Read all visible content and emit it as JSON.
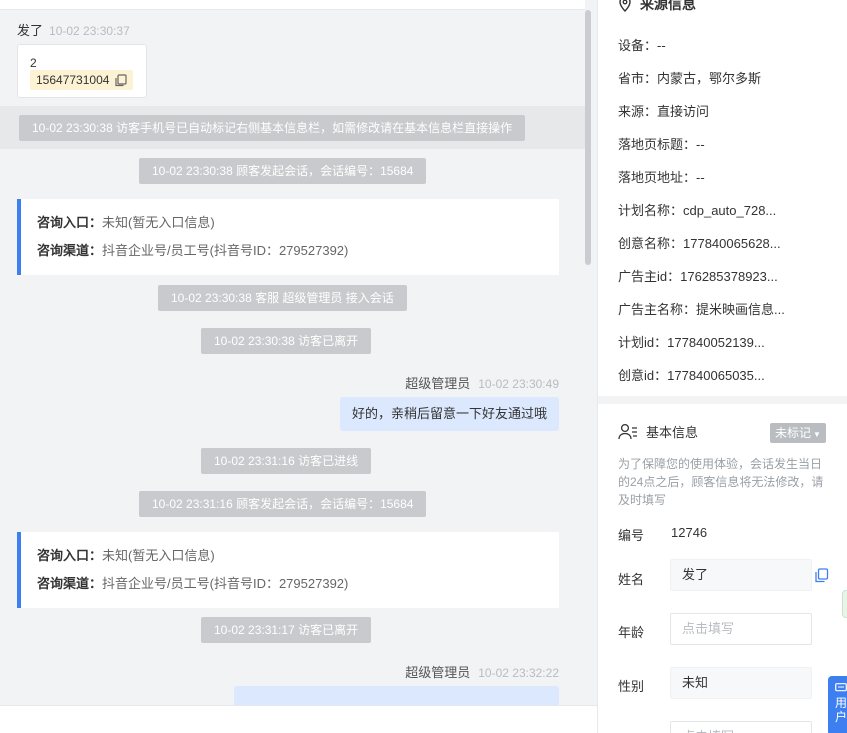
{
  "chat": {
    "top_sender": {
      "name": "发了",
      "time": "10-02 23:30:37"
    },
    "card": {
      "number": "2",
      "phone": "15647731004"
    },
    "system_messages": [
      "10-02 23:30:38 访客手机号已自动标记右侧基本信息栏，如需修改请在基本信息栏直接操作",
      "10-02 23:30:38 顾客发起会话，会话编号：15684",
      "10-02 23:30:38 客服 超级管理员 接入会话",
      "10-02 23:30:38 访客已离开",
      "10-02 23:31:16 访客已进线",
      "10-02 23:31:16 顾客发起会话，会话编号：15684",
      "10-02 23:31:17 访客已离开"
    ],
    "entries": [
      {
        "entry_label": "咨询入口：",
        "entry_value": "未知(暂无入口信息)",
        "channel_label": "咨询渠道：",
        "channel_value": "抖音企业号/员工号(抖音号ID：279527392)"
      },
      {
        "entry_label": "咨询入口：",
        "entry_value": "未知(暂无入口信息)",
        "channel_label": "咨询渠道：",
        "channel_value": "抖音企业号/员工号(抖音号ID：279527392)"
      }
    ],
    "agent_messages": [
      {
        "name": "超级管理员",
        "time": "10-02 23:30:49",
        "text": "好的，亲稍后留意一下好友通过哦"
      },
      {
        "name": "超级管理员",
        "time": "10-02 23:32:22",
        "text": ""
      }
    ]
  },
  "panel": {
    "source_title": "来源信息",
    "source_fields": [
      {
        "label": "设备：",
        "value": "--"
      },
      {
        "label": "省市：",
        "value": "内蒙古，鄂尔多斯"
      },
      {
        "label": "来源：",
        "value": "直接访问"
      },
      {
        "label": "落地页标题：",
        "value": "--"
      },
      {
        "label": "落地页地址：",
        "value": "--"
      },
      {
        "label": "计划名称：",
        "value": "cdp_auto_728..."
      },
      {
        "label": "创意名称：",
        "value": "177840065628..."
      },
      {
        "label": "广告主id：",
        "value": "176285378923..."
      },
      {
        "label": "广告主名称：",
        "value": "提米映画信息..."
      },
      {
        "label": "计划id：",
        "value": "177840052139..."
      },
      {
        "label": "创意id：",
        "value": "177840065035..."
      }
    ],
    "basic_title": "基本信息",
    "tag_label": "未标记",
    "tip": "为了保障您的使用体验，会话发生当日的24点之后，顾客信息将无法修改，请及时填写",
    "fields": {
      "id_label": "编号",
      "id_value": "12746",
      "name_label": "姓名",
      "name_value": "发了",
      "age_label": "年龄",
      "age_placeholder": "点击填写",
      "gender_label": "性别",
      "gender_value": "未知",
      "next_placeholder": "点击填写"
    },
    "float_button": "用户"
  },
  "colors": {
    "accent": "#3d7ff0",
    "system_bg": "#c8cacd",
    "bubble_bg": "#dbe8fd",
    "tag_bg": "#b9bcc1",
    "phone_highlight": "#fdf3d4"
  },
  "icons": [
    "copy-icon",
    "location-pin-icon",
    "user-list-icon",
    "caret-down-icon",
    "chat-icon"
  ]
}
